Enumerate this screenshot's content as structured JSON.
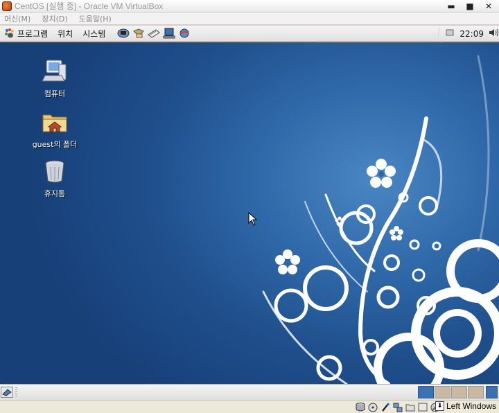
{
  "window": {
    "title": "CentOS [실행 중] - Oracle VM VirtualBox",
    "buttons": [
      "▬",
      "■",
      "✕"
    ]
  },
  "vbox_menu": [
    "머신(M)",
    "장치(D)",
    "도움말(H)"
  ],
  "gnome_top_panel": {
    "menus": [
      "프로그램",
      "위치",
      "시스템"
    ],
    "launchers": [
      "network-icon",
      "file-manager-icon",
      "text-editor-icon",
      "monitor-icon",
      "web-browser-icon"
    ],
    "clock": "22:09"
  },
  "desktop": {
    "icons": [
      {
        "label": "컴퓨터",
        "icon": "computer-icon"
      },
      {
        "label": "guest의 폴더",
        "icon": "home-folder-icon"
      },
      {
        "label": "휴지통",
        "icon": "trash-icon"
      }
    ],
    "colors": {
      "background": "#2f68a8",
      "swirl": "#ffffff"
    }
  },
  "vbox_status": {
    "host_key": "Left Windows",
    "indicators": [
      "hard-disk-icon",
      "optical-drive-icon",
      "usb-icon",
      "network-adapter-icon",
      "shared-folders-icon",
      "display-icon",
      "mouse-integration-icon"
    ]
  }
}
